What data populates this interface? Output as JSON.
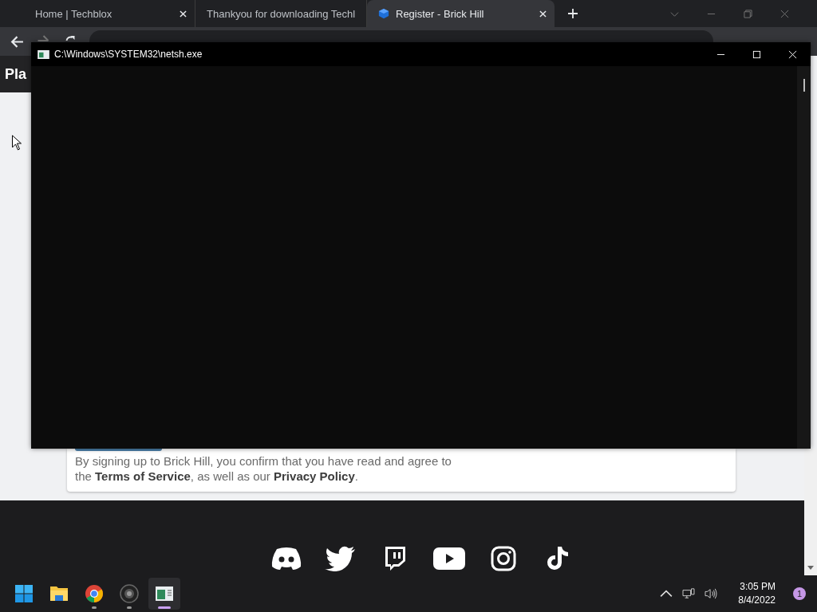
{
  "browser": {
    "tabs": [
      {
        "title": "Home | Techblox",
        "kind": "plain",
        "selected": false
      },
      {
        "title": "Thankyou for downloading Techl",
        "kind": "plain",
        "selected": false
      },
      {
        "title": "Register - Brick Hill",
        "kind": "cube",
        "selected": true
      }
    ]
  },
  "page": {
    "header_text": "Pla",
    "notice": "By signing up to Brick Hill, you confirm that you have read and agree to the **Terms of Service**, as well as our **Privacy Policy**."
  },
  "console": {
    "title": "C:\\Windows\\SYSTEM32\\netsh.exe"
  },
  "taskbar": {
    "apps": [
      {
        "kind": "start",
        "selected": false
      },
      {
        "kind": "folder",
        "selected": false
      },
      {
        "kind": "browser",
        "selected": false
      },
      {
        "kind": "camera",
        "selected": false
      },
      {
        "kind": "console",
        "selected": true
      }
    ],
    "time": "3:05 PM",
    "date": "8/4/2022",
    "notifications": "1"
  }
}
